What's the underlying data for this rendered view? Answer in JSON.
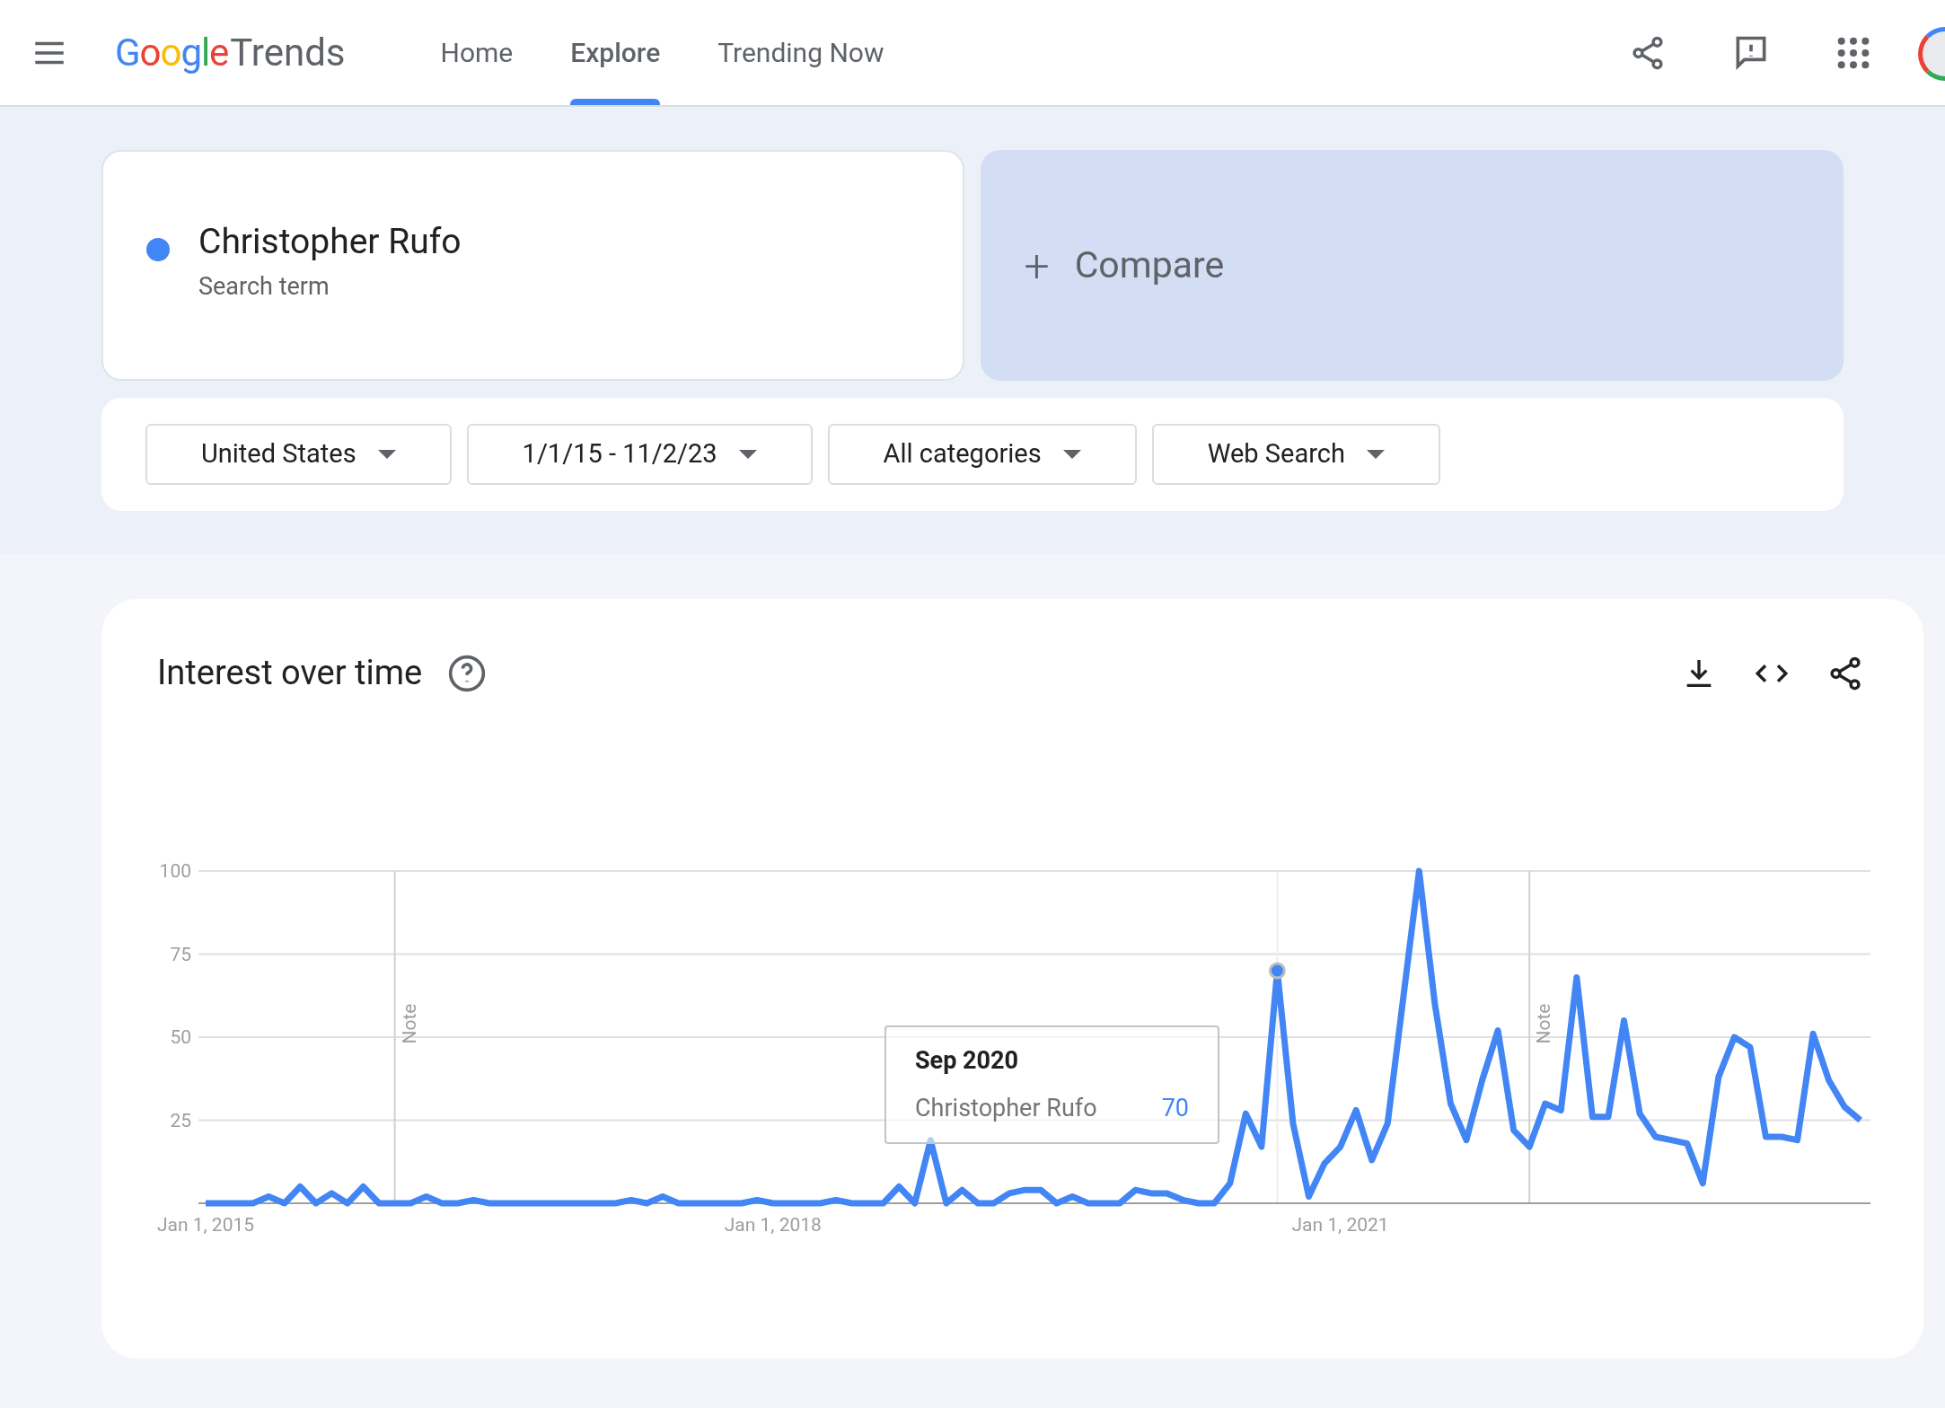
{
  "header": {
    "logo": {
      "brand": "Google",
      "product": "Trends"
    },
    "nav": [
      {
        "label": "Home",
        "selected": false
      },
      {
        "label": "Explore",
        "selected": true
      },
      {
        "label": "Trending Now",
        "selected": false
      }
    ]
  },
  "search_term": {
    "name": "Christopher Rufo",
    "type": "Search term",
    "color": "#4285f4"
  },
  "compare": {
    "label": "Compare",
    "icon": "+"
  },
  "filters": [
    {
      "label": "United States"
    },
    {
      "label": "1/1/15 - 11/2/23"
    },
    {
      "label": "All categories"
    },
    {
      "label": "Web Search"
    }
  ],
  "interest_over_time": {
    "title": "Interest over time",
    "x_axis_labels": [
      "Jan 1, 2015",
      "Jan 1, 2018",
      "Jan 1, 2021"
    ],
    "notes": [
      "Note",
      "Note"
    ],
    "tooltip": {
      "date": "Sep 2020",
      "value": "70"
    },
    "chart_data": {
      "type": "line",
      "ylim": [
        0,
        100
      ],
      "yticks": [
        25,
        50,
        75,
        100
      ],
      "grid": true,
      "series": [
        {
          "name": "Christopher Rufo",
          "color": "#4285f4",
          "values": [
            0,
            0,
            0,
            0,
            2,
            0,
            5,
            0,
            3,
            0,
            5,
            0,
            0,
            0,
            2,
            0,
            0,
            1,
            0,
            0,
            0,
            0,
            0,
            0,
            0,
            0,
            0,
            1,
            0,
            2,
            0,
            0,
            0,
            0,
            0,
            1,
            0,
            0,
            0,
            0,
            1,
            0,
            0,
            0,
            5,
            0,
            19,
            0,
            4,
            0,
            0,
            3,
            4,
            4,
            0,
            2,
            0,
            0,
            0,
            4,
            3,
            3,
            1,
            0,
            0,
            6,
            27,
            17,
            70,
            24,
            2,
            12,
            17,
            28,
            13,
            24,
            62,
            100,
            60,
            30,
            19,
            37,
            52,
            22,
            17,
            30,
            28,
            68,
            26,
            26,
            55,
            27,
            20,
            19,
            18,
            6,
            38,
            50,
            47,
            20,
            20,
            19,
            51,
            37,
            29,
            25
          ]
        }
      ]
    }
  }
}
